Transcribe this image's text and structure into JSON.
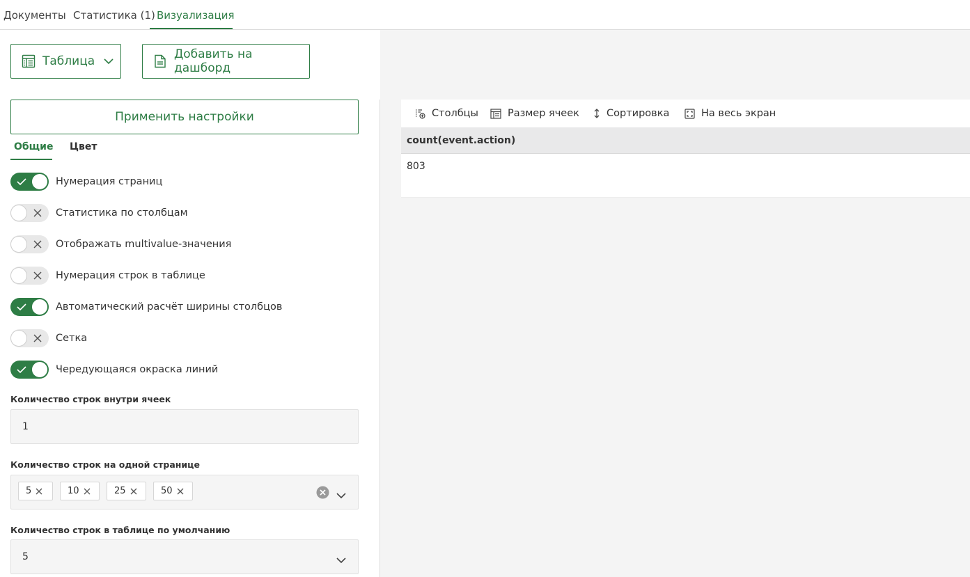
{
  "top_tabs": [
    {
      "label": "Документы",
      "active": false
    },
    {
      "label": "Статистика (1)",
      "active": false
    },
    {
      "label": "Визуализация",
      "active": true
    }
  ],
  "toolbar": {
    "view_type": "Таблица",
    "add_to_dashboard": "Добавить на дашборд"
  },
  "settings": {
    "apply_label": "Применить настройки",
    "sub_tabs": [
      {
        "label": "Общие",
        "active": true
      },
      {
        "label": "Цвет",
        "active": false
      }
    ],
    "toggles": [
      {
        "label": "Нумерация страниц",
        "on": true
      },
      {
        "label": "Статистика по столбцам",
        "on": false
      },
      {
        "label": "Отображать multivalue-значения",
        "on": false
      },
      {
        "label": "Нумерация строк в таблице",
        "on": false
      },
      {
        "label": "Автоматический расчёт ширины столбцов",
        "on": true
      },
      {
        "label": "Сетка",
        "on": false
      },
      {
        "label": "Чередующаяся окраска линий",
        "on": true
      }
    ],
    "rows_in_cell": {
      "label": "Количество строк внутри ячеек",
      "value": "1"
    },
    "rows_per_page": {
      "label": "Количество строк на одной странице",
      "options": [
        "5",
        "10",
        "25",
        "50"
      ]
    },
    "default_rows": {
      "label": "Количество строк в таблице по умолчанию",
      "value": "5"
    }
  },
  "table_toolbar": {
    "columns": "Столбцы",
    "cell_size": "Размер ячеек",
    "sorting": "Сортировка",
    "fullscreen": "На весь экран"
  },
  "table": {
    "columns": [
      "count(event.action)"
    ],
    "rows": [
      [
        "803"
      ]
    ]
  },
  "colors": {
    "accent": "#2e7d45",
    "header_bg": "#e9e9ea",
    "field_bg": "#f5f5f5"
  }
}
